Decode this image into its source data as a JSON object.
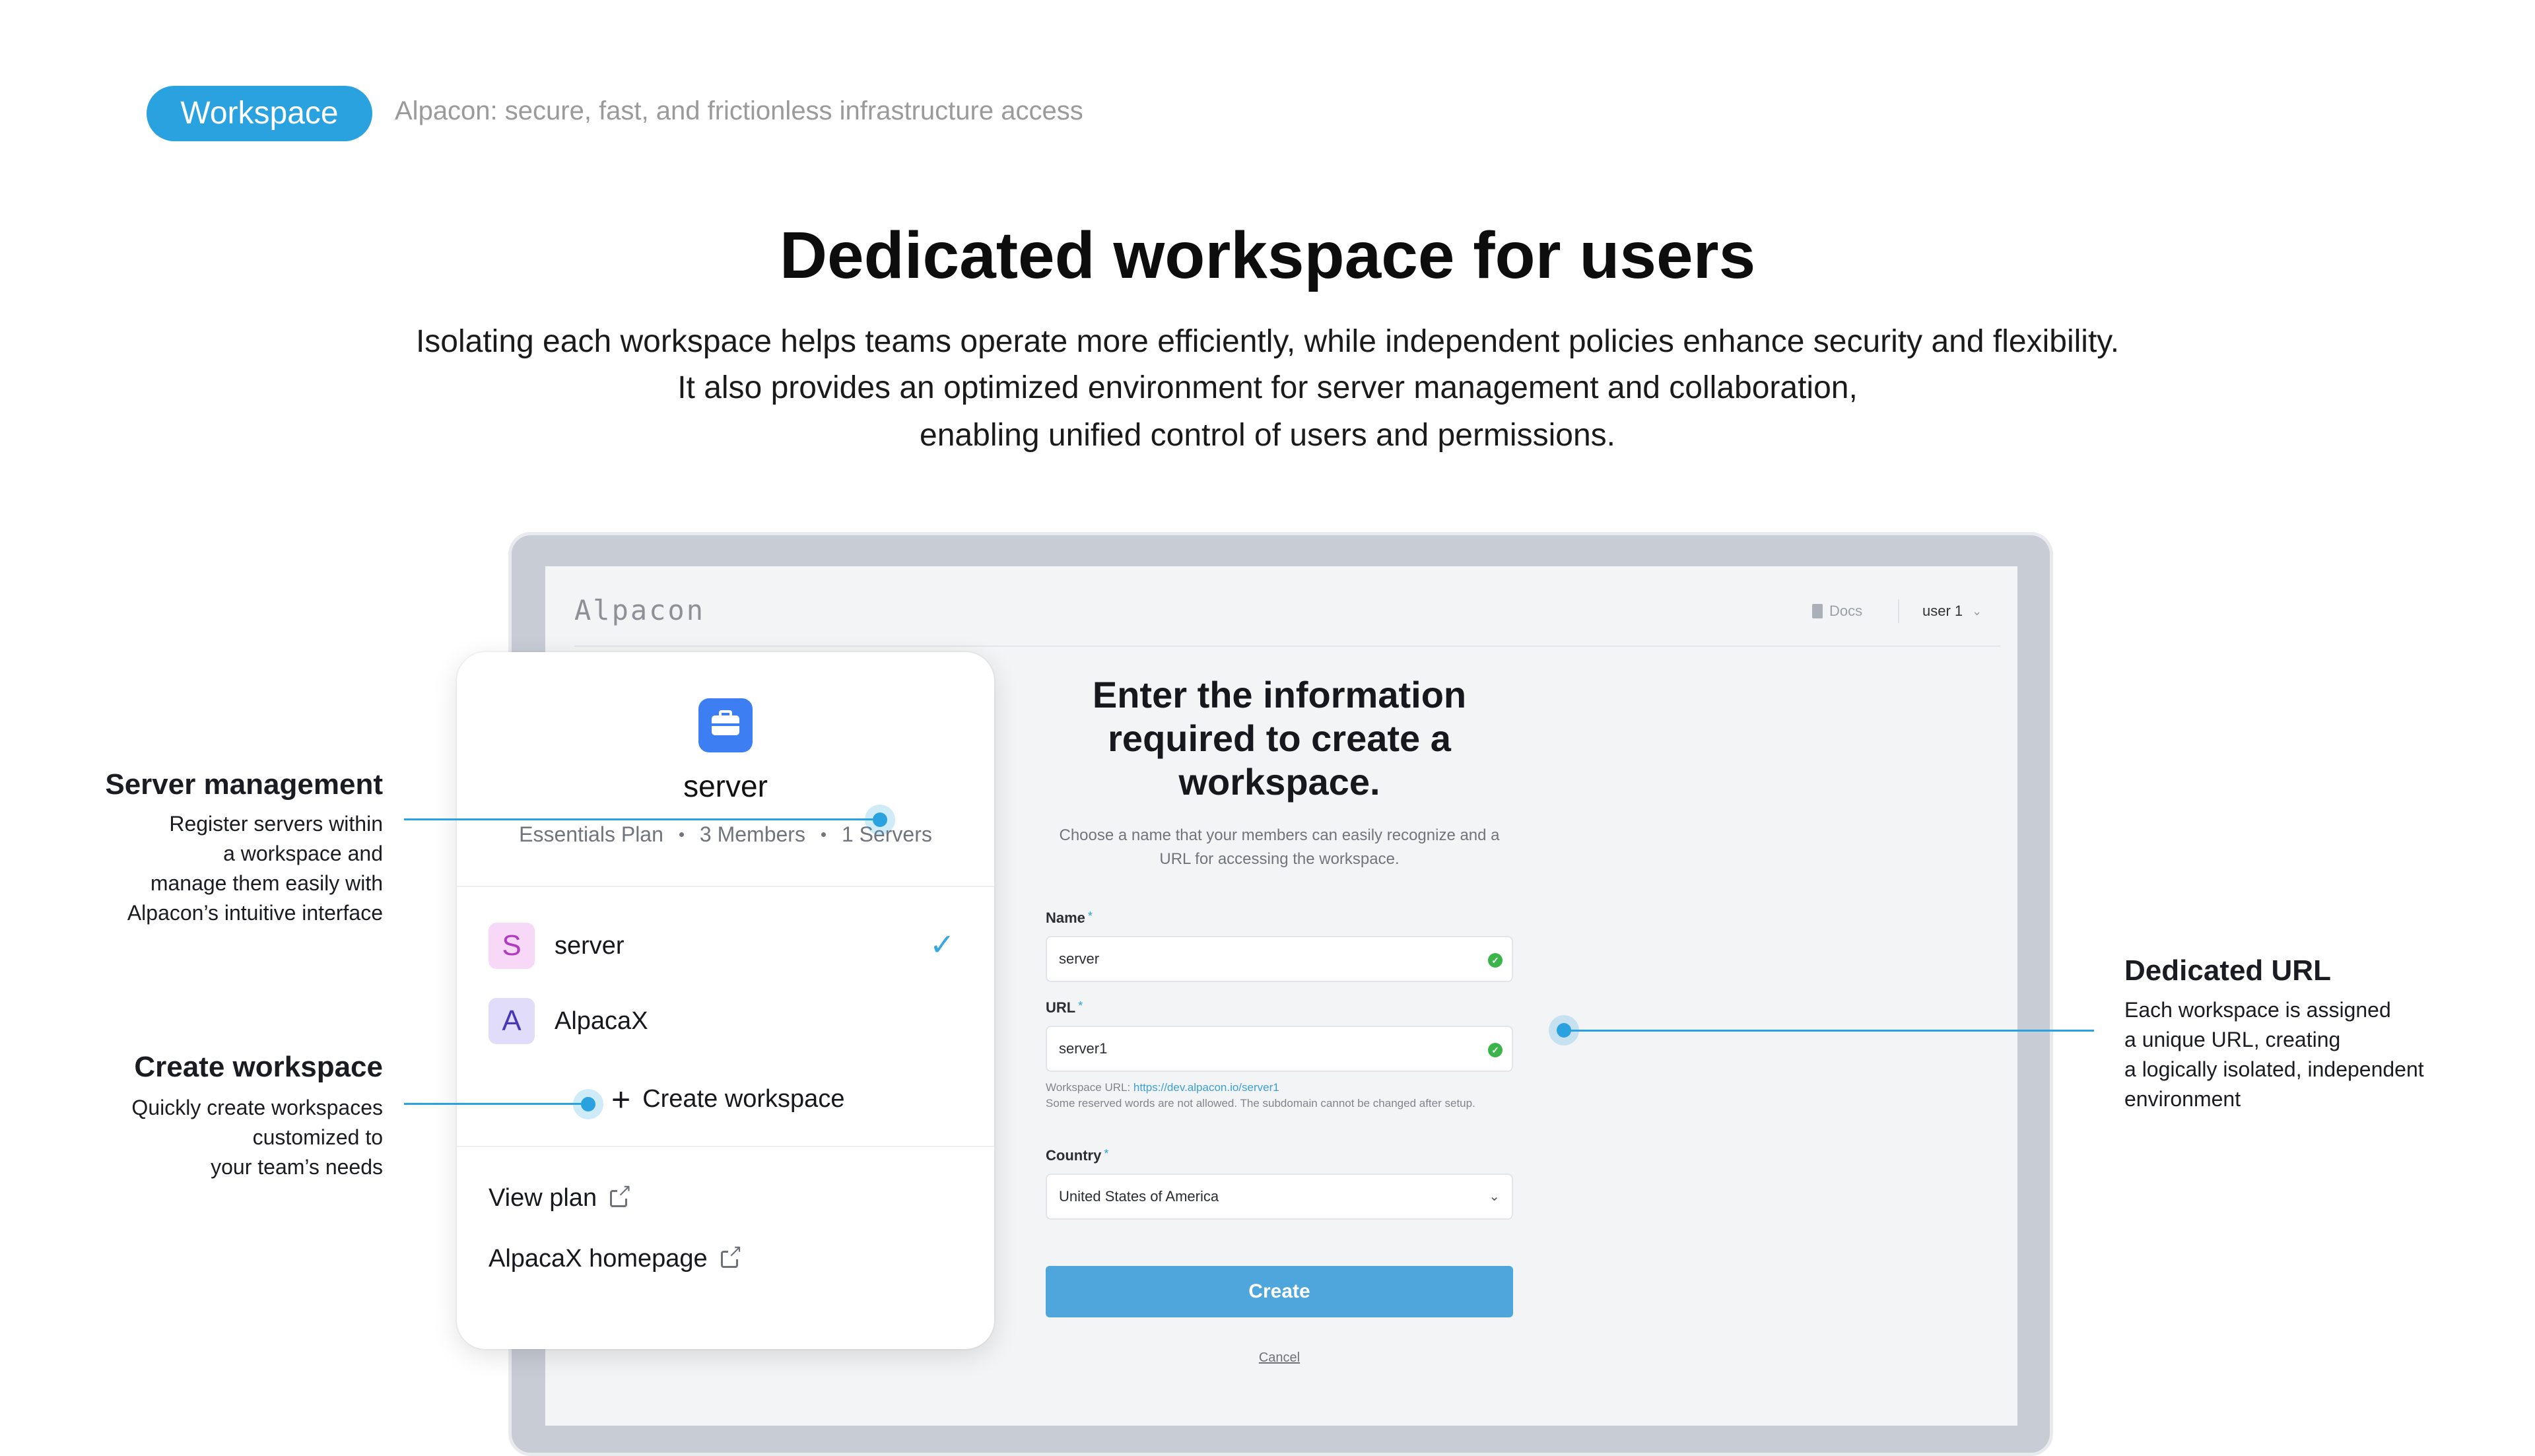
{
  "header": {
    "badge": "Workspace",
    "tagline": "Alpacon: secure, fast, and frictionless infrastructure access"
  },
  "hero": {
    "title": "Dedicated workspace for users",
    "lines": [
      "Isolating each workspace helps teams operate more efficiently, while independent policies enhance security and flexibility.",
      "It also provides an optimized environment for server management and collaboration,",
      "enabling unified control of users and permissions."
    ]
  },
  "app": {
    "logo": "Alpacon",
    "docs_label": "Docs",
    "user_label": "user 1"
  },
  "form": {
    "title": "Enter the information required to create a workspace.",
    "description": "Choose a name that your members can easily recognize and a URL for accessing the workspace.",
    "name_label": "Name",
    "name_value": "server",
    "url_label": "URL",
    "url_value": "server1",
    "url_help_prefix": "Workspace URL: ",
    "url_help_link": "https://dev.alpacon.io/server1",
    "url_help_note": "Some reserved words are not allowed. The subdomain cannot be changed after setup.",
    "country_label": "Country",
    "country_value": "United States of America",
    "required_mark": "*",
    "create_label": "Create",
    "cancel_label": "Cancel"
  },
  "workspace_menu": {
    "current_name": "server",
    "plan": "Essentials Plan",
    "members": "3 Members",
    "servers": "1 Servers",
    "items": [
      {
        "initial": "S",
        "name": "server",
        "selected": true
      },
      {
        "initial": "A",
        "name": "AlpacaX",
        "selected": false
      }
    ],
    "create_label": "Create workspace",
    "view_plan_label": "View plan",
    "homepage_label": "AlpacaX homepage"
  },
  "callouts": {
    "server_management": {
      "title": "Server management",
      "body": [
        "Register servers within",
        "a workspace and",
        "manage them easily with",
        "Alpacon’s intuitive interface"
      ]
    },
    "create_workspace": {
      "title": "Create workspace",
      "body": [
        "Quickly create workspaces",
        "customized to",
        "your team’s needs"
      ]
    },
    "dedicated_url": {
      "title": "Dedicated URL",
      "body": [
        "Each workspace is assigned",
        "a unique URL, creating",
        "a logically isolated, independent",
        "environment"
      ]
    }
  },
  "colors": {
    "accent": "#2aa2e0",
    "button": "#4ea6dd",
    "workspace_icon": "#3d7ff2",
    "success": "#3bb54a"
  },
  "icons": [
    "briefcase-icon",
    "check-icon",
    "plus-icon",
    "external-link-icon",
    "docs-icon",
    "chevron-down-icon",
    "success-check-icon"
  ]
}
